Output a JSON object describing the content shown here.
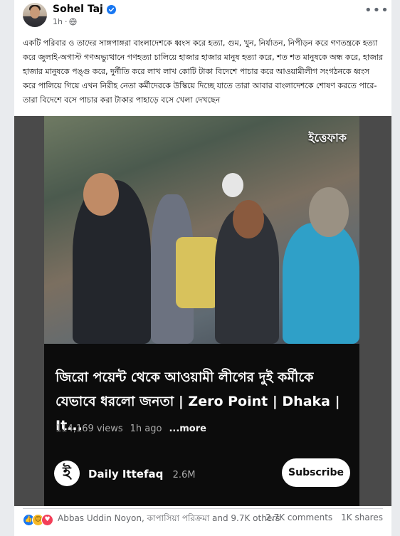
{
  "post": {
    "author": "Sohel Taj",
    "time": "1h",
    "more_label": "•••",
    "text": "একটি পরিবার ও তাদের সাঙ্গপাঙ্গরা বাংলাদেশকে ধ্বংস করে হত্যা, গুম, খুন, নির্যাতন, নিপীড়ন করে গণতন্ত্রকে হত্যা করে জুলাই-অগাস্ট গণঅভ্যুত্থানে গণহত্যা চালিয়ে হাজার হাজার মানুষ হত্যা করে, শত শত মানুষকে অন্ধ করে, হাজার হাজার মানুষকে পঙ্গু করে, দুর্নীতি করে লাখ লাখ কোটি টাকা বিদেশে পাচার করে আওয়ামীলীগ সংগঠনকে ধ্বংস করে পালিয়ে গিয়ে এখন নিরীহ নেতা কর্মীদেরকে উস্কিয়ে দিচ্ছে যাতে তারা আবার বাংলাদেশকে শোষণ করতে পারে- তারা বিদেশে বসে পাচার করা টাকার পাহাড়ে বসে খেলা দেখছেন"
  },
  "video": {
    "watermark": "ইত্তেফাক",
    "title": "জিরো পয়েন্ট থেকে আওয়ামী লীগের দুই কর্মীকে যেভাবে ধরলো জনতা  | Zero Point | Dhaka | It...",
    "views": "114,169 views",
    "age": "1h ago",
    "more_label": "...more",
    "channel_name": "Daily Ittefaq",
    "channel_subs": "2.6M",
    "channel_logo_glyph": "ই",
    "subscribe_label": "Subscribe"
  },
  "footer": {
    "reactions_text": "Abbas Uddin Noyon, কাপাসিয়া পরিক্রমা and 9.7K others",
    "comments": "2.7K comments",
    "shares": "1K shares"
  },
  "colors": {
    "accent": "#1877f2",
    "like": "#1877f2",
    "haha": "#f7b928",
    "love": "#f33e58"
  }
}
